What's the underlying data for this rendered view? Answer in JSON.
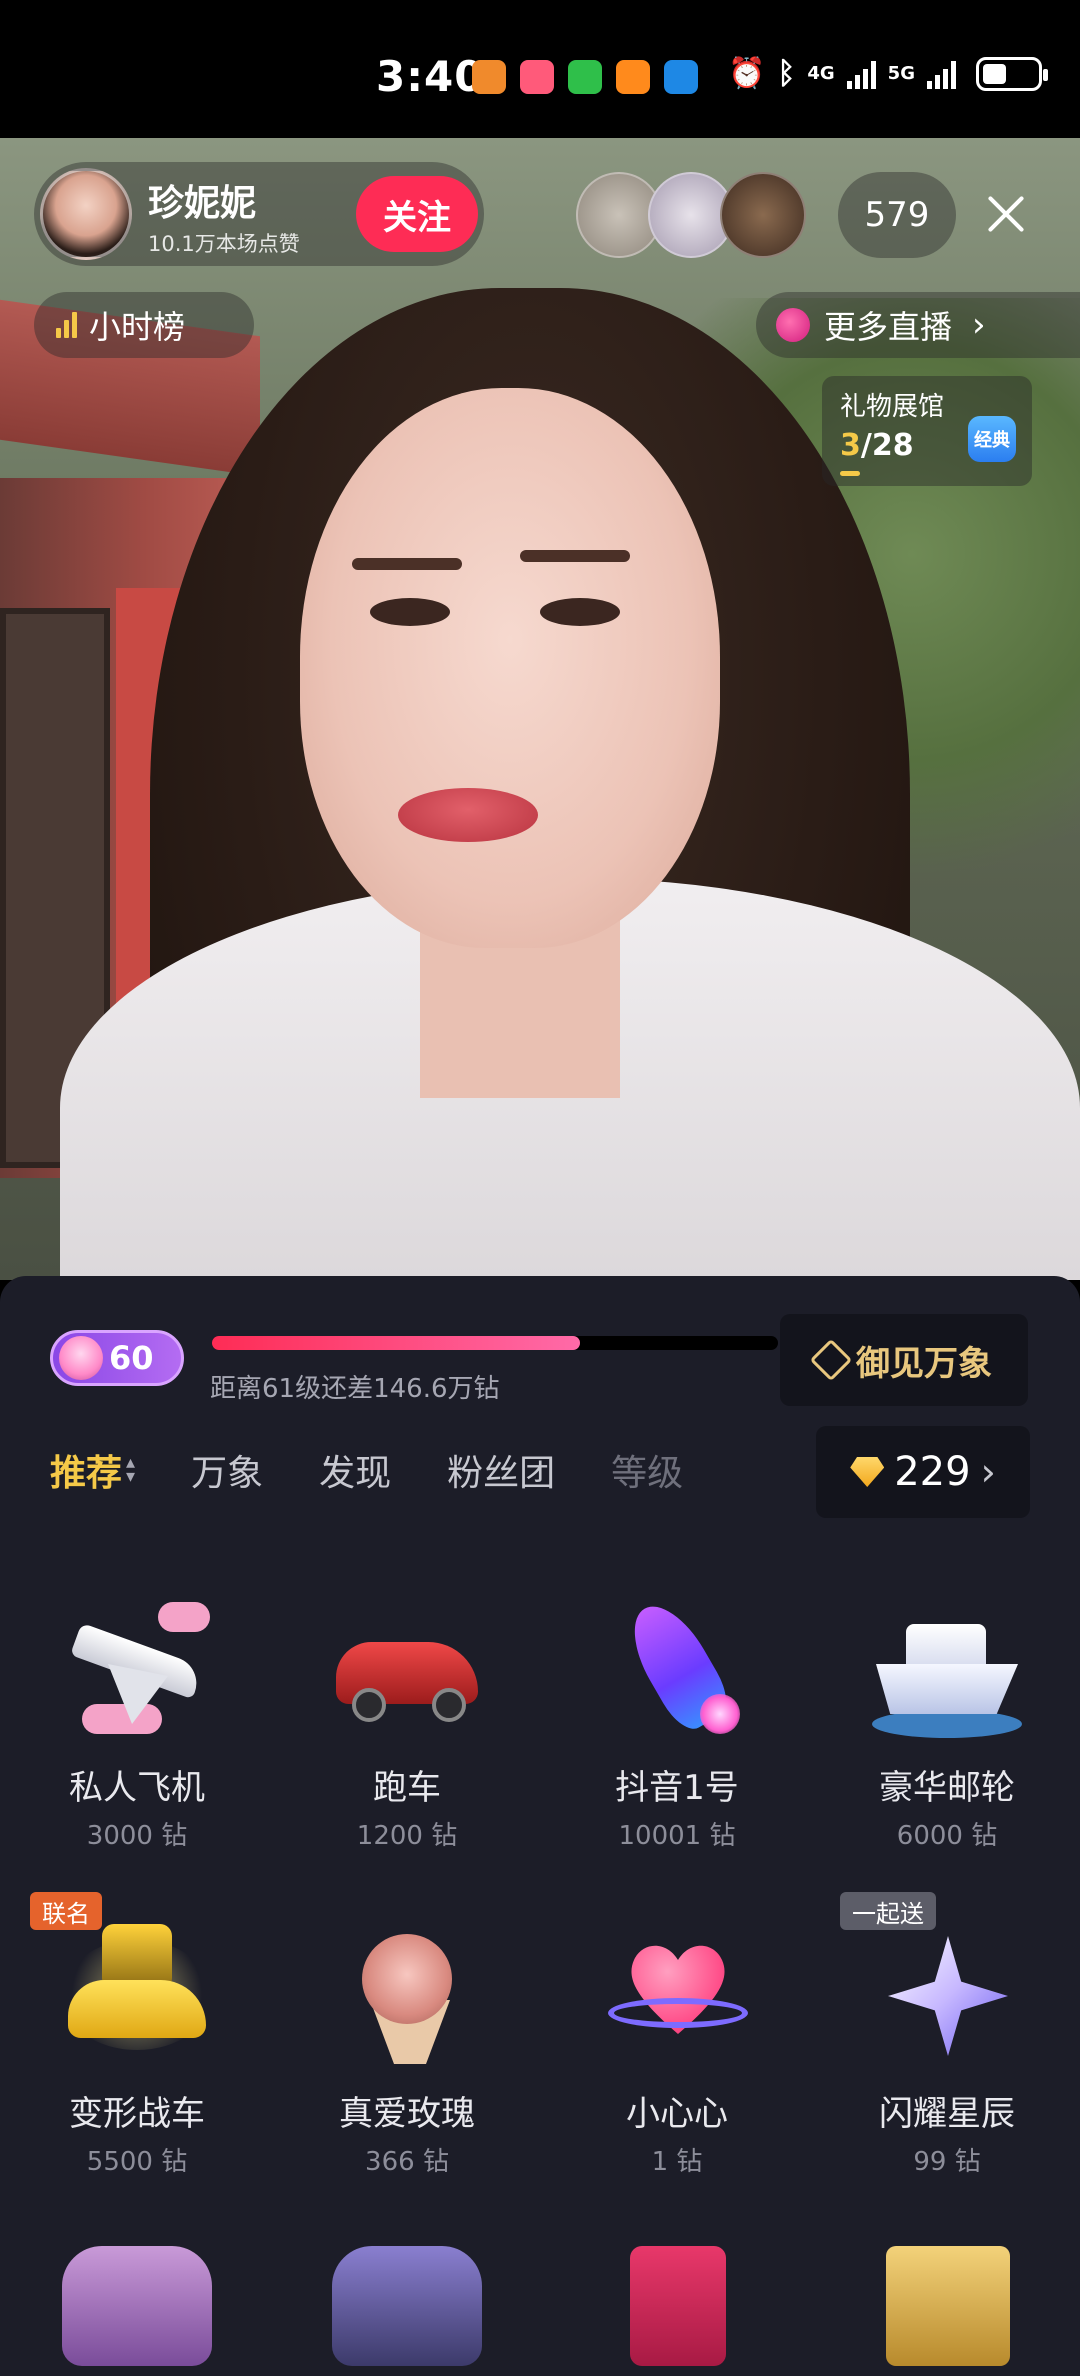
{
  "status_bar": {
    "time": "3:40",
    "network_1": "4G",
    "network_2": "5G"
  },
  "host": {
    "name": "珍妮妮",
    "likes": "10.1万本场点赞",
    "follow_label": "关注"
  },
  "viewer_count": "579",
  "hour_rank_label": "小时榜",
  "more_live_label": "更多直播",
  "gift_hall": {
    "title": "礼物展馆",
    "progress_current": "3",
    "progress_total": "/28",
    "badge": "经典"
  },
  "panel": {
    "level": "60",
    "level_progress": 0.65,
    "level_text": "距离61级还差146.6万钻",
    "yujian_label": "御见万象",
    "tabs": [
      {
        "label": "推荐"
      },
      {
        "label": "万象"
      },
      {
        "label": "发现"
      },
      {
        "label": "粉丝团"
      },
      {
        "label": "等级"
      }
    ],
    "balance": "229",
    "balance_chevron": "›"
  },
  "gifts": [
    {
      "name": "私人飞机",
      "price": "3000 钻",
      "icon": "private-jet-icon"
    },
    {
      "name": "跑车",
      "price": "1200 钻",
      "icon": "sports-car-icon"
    },
    {
      "name": "抖音1号",
      "price": "10001 钻",
      "icon": "rocket-icon"
    },
    {
      "name": "豪华邮轮",
      "price": "6000 钻",
      "icon": "cruise-ship-icon"
    },
    {
      "name": "变形战车",
      "price": "5500 钻",
      "icon": "transformer-car-icon",
      "tag": "联名"
    },
    {
      "name": "真爱玫瑰",
      "price": "366 钻",
      "icon": "rose-bouquet-icon"
    },
    {
      "name": "小心心",
      "price": "1 钻",
      "icon": "heart-icon"
    },
    {
      "name": "闪耀星辰",
      "price": "99 钻",
      "icon": "star-icon",
      "tag": "一起送"
    }
  ],
  "colors": {
    "accent_red": "#fe2c55",
    "accent_gold": "#f5c948",
    "panel_bg": "#1c1d28"
  }
}
